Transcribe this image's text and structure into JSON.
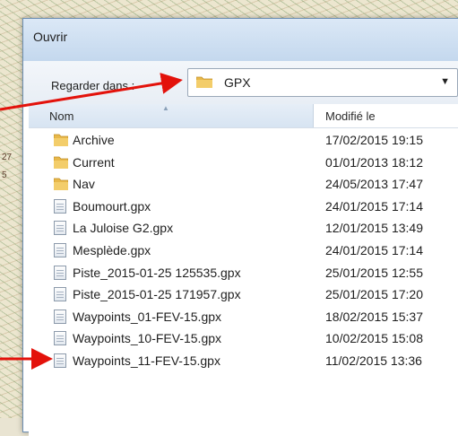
{
  "dialog": {
    "title": "Ouvrir",
    "look_in_label": "Regarder dans :",
    "look_in_value": "GPX",
    "dropdown_icon": "chevron-down-icon"
  },
  "columns": {
    "name": "Nom",
    "modified": "Modifié le"
  },
  "rows": [
    {
      "type": "folder",
      "name": "Archive",
      "modified": "17/02/2015 19:15"
    },
    {
      "type": "folder",
      "name": "Current",
      "modified": "01/01/2013 18:12"
    },
    {
      "type": "folder",
      "name": "Nav",
      "modified": "24/05/2013 17:47"
    },
    {
      "type": "file",
      "name": "Boumourt.gpx",
      "modified": "24/01/2015 17:14"
    },
    {
      "type": "file",
      "name": "La Juloise G2.gpx",
      "modified": "12/01/2015 13:49"
    },
    {
      "type": "file",
      "name": "Mesplède.gpx",
      "modified": "24/01/2015 17:14"
    },
    {
      "type": "file",
      "name": "Piste_2015-01-25 125535.gpx",
      "modified": "25/01/2015 12:55"
    },
    {
      "type": "file",
      "name": "Piste_2015-01-25 171957.gpx",
      "modified": "25/01/2015 17:20"
    },
    {
      "type": "file",
      "name": "Waypoints_01-FEV-15.gpx",
      "modified": "18/02/2015 15:37"
    },
    {
      "type": "file",
      "name": "Waypoints_10-FEV-15.gpx",
      "modified": "10/02/2015 15:08"
    },
    {
      "type": "file",
      "name": "Waypoints_11-FEV-15.gpx",
      "modified": "11/02/2015 13:36"
    }
  ],
  "colors": {
    "folder": "#e8b84a",
    "annotation_arrow": "#e3120b",
    "titlebar": "#c4d8ee"
  },
  "map_labels": [
    "27",
    "5"
  ]
}
